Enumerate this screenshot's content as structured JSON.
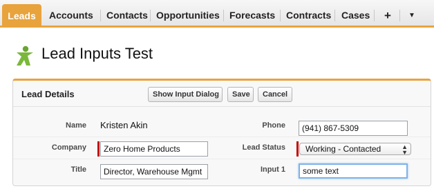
{
  "tabs": [
    {
      "label": "Leads",
      "active": true
    },
    {
      "label": "Accounts"
    },
    {
      "label": "Contacts"
    },
    {
      "label": "Opportunities"
    },
    {
      "label": "Forecasts"
    },
    {
      "label": "Contracts"
    },
    {
      "label": "Cases"
    },
    {
      "label": "+"
    },
    {
      "label": "▼"
    }
  ],
  "header": {
    "icon": "lead-person-icon",
    "title": "Lead Inputs Test"
  },
  "panel": {
    "title": "Lead Details",
    "buttons": {
      "show_input_dialog": "Show Input Dialog",
      "save": "Save",
      "cancel": "Cancel"
    }
  },
  "fields": {
    "name": {
      "label": "Name",
      "value": "Kristen Akin"
    },
    "phone": {
      "label": "Phone",
      "value": "(941) 867-5309"
    },
    "company": {
      "label": "Company",
      "value": "Zero Home Products"
    },
    "lead_status": {
      "label": "Lead Status",
      "value": "Working - Contacted"
    },
    "title": {
      "label": "Title",
      "value": "Director, Warehouse Mgmt"
    },
    "input1": {
      "label": "Input 1",
      "value": "some text"
    }
  },
  "colors": {
    "accent": "#e8a33d",
    "required": "#c00000",
    "focus": "#7fb2e8"
  }
}
